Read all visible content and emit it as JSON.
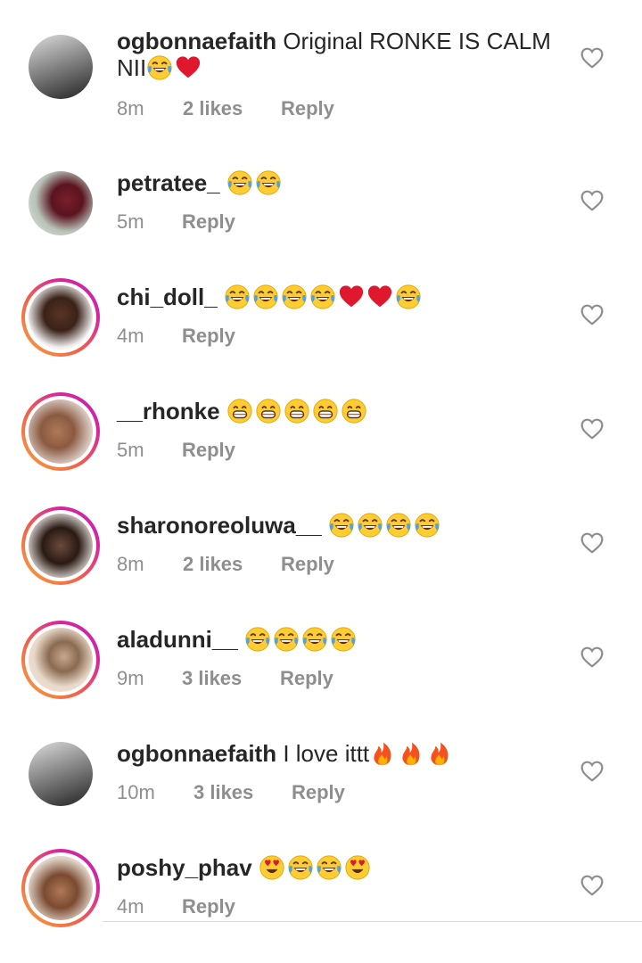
{
  "comments": [
    {
      "username": "ogbonnaefaith",
      "text": "Original RONKE IS CALM NII",
      "emojis": [
        "laugh-cry",
        "red-heart"
      ],
      "time": "8m",
      "likes": "2 likes",
      "reply": "Reply",
      "ring": false
    },
    {
      "username": "petratee_",
      "text": "",
      "emojis": [
        "laugh-cry",
        "laugh-cry"
      ],
      "time": "5m",
      "likes": "",
      "reply": "Reply",
      "ring": false
    },
    {
      "username": "chi_doll_",
      "text": "",
      "emojis": [
        "laugh-cry",
        "laugh-cry",
        "laugh-cry",
        "laugh-cry",
        "red-heart",
        "red-heart",
        "laugh-cry"
      ],
      "time": "4m",
      "likes": "",
      "reply": "Reply",
      "ring": true
    },
    {
      "username": "__rhonke",
      "text": "",
      "emojis": [
        "grin",
        "grin",
        "grin",
        "grin",
        "grin"
      ],
      "time": "5m",
      "likes": "",
      "reply": "Reply",
      "ring": true
    },
    {
      "username": "sharonoreoluwa__",
      "text": "",
      "emojis": [
        "laugh-cry",
        "laugh-cry",
        "laugh-cry",
        "laugh-cry"
      ],
      "time": "8m",
      "likes": "2 likes",
      "reply": "Reply",
      "ring": true
    },
    {
      "username": "aladunni__",
      "text": "",
      "emojis": [
        "laugh-cry",
        "laugh-cry",
        "laugh-cry",
        "laugh-cry"
      ],
      "time": "9m",
      "likes": "3 likes",
      "reply": "Reply",
      "ring": true
    },
    {
      "username": "ogbonnaefaith",
      "text": "I love ittt",
      "emojis": [
        "fire",
        "fire",
        "fire"
      ],
      "time": "10m",
      "likes": "3 likes",
      "reply": "Reply",
      "ring": false
    },
    {
      "username": "poshy_phav",
      "text": "",
      "emojis": [
        "heart-eyes",
        "laugh-cry",
        "laugh-cry",
        "heart-eyes"
      ],
      "time": "4m",
      "likes": "",
      "reply": "Reply",
      "ring": true
    }
  ],
  "colors": {
    "meta": "#8e8e8e",
    "text": "#262626",
    "ring_start": "#f9a53a",
    "ring_end": "#b62cc0",
    "heart_outline": "#8e8e8e"
  }
}
